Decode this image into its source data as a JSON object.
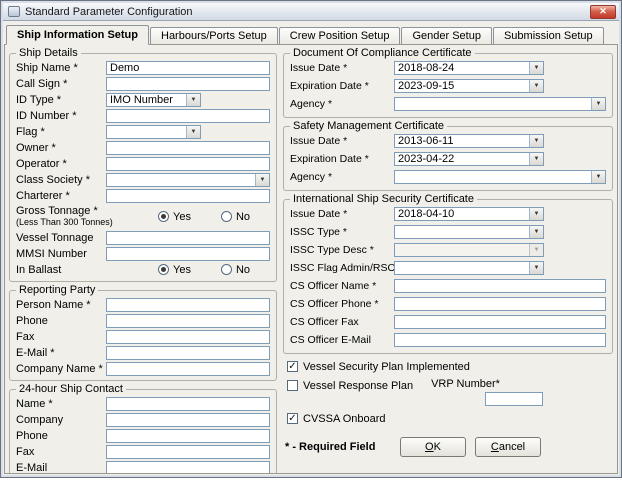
{
  "window": {
    "title": "Standard Parameter Configuration"
  },
  "icons": {
    "close": "✕",
    "dropdown": "▼",
    "check": "✓"
  },
  "tabs": {
    "items": [
      "Ship Information Setup",
      "Harbours/Ports Setup",
      "Crew Position Setup",
      "Gender Setup",
      "Submission Setup"
    ]
  },
  "ship_details": {
    "legend": "Ship Details",
    "ship_name_label": "Ship Name *",
    "ship_name_value": "Demo",
    "call_sign_label": "Call Sign *",
    "call_sign_value": "",
    "id_type_label": "ID Type *",
    "id_type_value": "IMO Number",
    "id_number_label": "ID Number *",
    "id_number_value": "",
    "flag_label": "Flag *",
    "flag_value": "",
    "owner_label": "Owner *",
    "owner_value": "",
    "operator_label": "Operator *",
    "operator_value": "",
    "class_society_label": "Class Society *",
    "class_society_value": "",
    "charterer_label": "Charterer *",
    "charterer_value": "",
    "gross_tonnage_label": "Gross Tonnage *",
    "gross_tonnage_sublabel": "(Less Than 300 Tonnes)",
    "yes_label": "Yes",
    "no_label": "No",
    "gross_tonnage_yes_checked": true,
    "gross_tonnage_no_checked": false,
    "vessel_tonnage_label": "Vessel Tonnage",
    "vessel_tonnage_value": "",
    "mmsi_label": "MMSI Number",
    "mmsi_value": "",
    "in_ballast_label": "In Ballast",
    "in_ballast_yes_checked": true,
    "in_ballast_no_checked": false
  },
  "reporting_party": {
    "legend": "Reporting Party",
    "person_name_label": "Person Name *",
    "person_name_value": "",
    "phone_label": "Phone",
    "phone_value": "",
    "fax_label": "Fax",
    "fax_value": "",
    "email_label": "E-Mail *",
    "email_value": "",
    "company_name_label": "Company Name *",
    "company_name_value": ""
  },
  "ship_contact": {
    "legend": "24-hour Ship Contact",
    "name_label": "Name *",
    "name_value": "",
    "company_label": "Company",
    "company_value": "",
    "phone_label": "Phone",
    "phone_value": "",
    "fax_label": "Fax",
    "fax_value": "",
    "email_label": "E-Mail",
    "email_value": ""
  },
  "doc_certificate": {
    "legend": "Document Of Compliance Certificate",
    "issue_date_label": "Issue Date *",
    "issue_date_value": "2018-08-24",
    "expiration_date_label": "Expiration Date *",
    "expiration_date_value": "2023-09-15",
    "agency_label": "Agency *",
    "agency_value": ""
  },
  "safety_certificate": {
    "legend": "Safety Management Certificate",
    "issue_date_label": "Issue Date *",
    "issue_date_value": "2013-06-11",
    "expiration_date_label": "Expiration Date *",
    "expiration_date_value": "2023-04-22",
    "agency_label": "Agency *",
    "agency_value": ""
  },
  "issc_certificate": {
    "legend": "International Ship Security Certificate",
    "issue_date_label": "Issue Date *",
    "issue_date_value": "2018-04-10",
    "issc_type_label": "ISSC Type *",
    "issc_type_value": "",
    "issc_type_desc_label": "ISSC Type Desc *",
    "issc_type_desc_value": "",
    "flag_admin_label": "ISSC Flag Admin/RSO *",
    "flag_admin_value": "",
    "cs_officer_name_label": "CS Officer Name *",
    "cs_officer_name_value": "",
    "cs_officer_phone_label": "CS Officer Phone *",
    "cs_officer_phone_value": "",
    "cs_officer_fax_label": "CS Officer Fax",
    "cs_officer_fax_value": "",
    "cs_officer_email_label": "CS Officer E-Mail",
    "cs_officer_email_value": ""
  },
  "security_options": {
    "vessel_security_plan_label": "Vessel Security Plan Implemented",
    "vessel_security_plan_checked": true,
    "vessel_response_plan_label": "Vessel Response Plan",
    "vessel_response_plan_checked": false,
    "vrp_number_label": "VRP Number*",
    "vrp_number_value": "",
    "cvssa_label": "CVSSA Onboard",
    "cvssa_checked": true
  },
  "footer": {
    "required_note": "* - Required Field",
    "ok_label": "OK",
    "cancel_label": "Cancel"
  }
}
